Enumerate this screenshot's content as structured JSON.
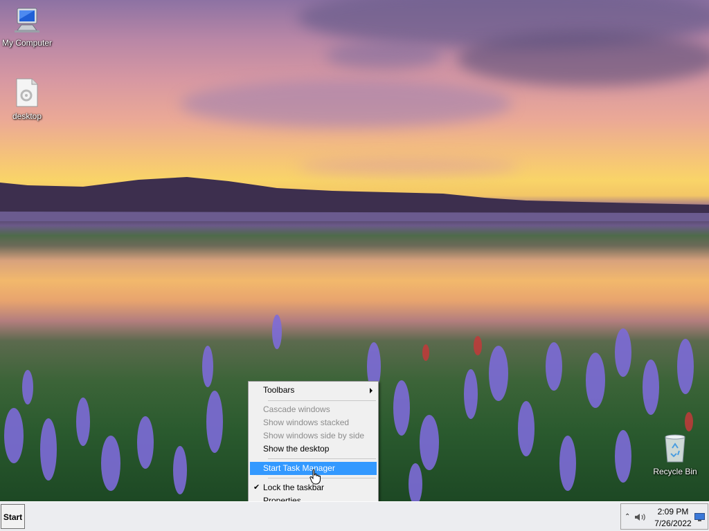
{
  "desktop": {
    "icons": [
      {
        "label": "My Computer"
      },
      {
        "label": "desktop"
      },
      {
        "label": "Recycle Bin"
      }
    ]
  },
  "context_menu": {
    "items": [
      {
        "label": "Toolbars",
        "has_submenu": true
      },
      {
        "label": "Cascade windows",
        "disabled": true
      },
      {
        "label": "Show windows stacked",
        "disabled": true
      },
      {
        "label": "Show windows side by side",
        "disabled": true
      },
      {
        "label": "Show the desktop"
      },
      {
        "label": "Start Task Manager",
        "highlighted": true
      },
      {
        "label": "Lock the taskbar",
        "checked": true
      },
      {
        "label": "Properties"
      }
    ]
  },
  "taskbar": {
    "start_label": "Start",
    "clock_time": "2:09 PM",
    "clock_date": "7/26/2022"
  },
  "colors": {
    "menu_highlight": "#3399ff",
    "menu_disabled_text": "#8c8c8c"
  },
  "icons": [
    "my-computer-icon",
    "document-icon",
    "recycle-bin-icon",
    "submenu-arrow-icon",
    "checkmark-icon",
    "tray-chevron-icon",
    "speaker-icon",
    "desktop-peek-icon",
    "mouse-cursor-icon"
  ]
}
